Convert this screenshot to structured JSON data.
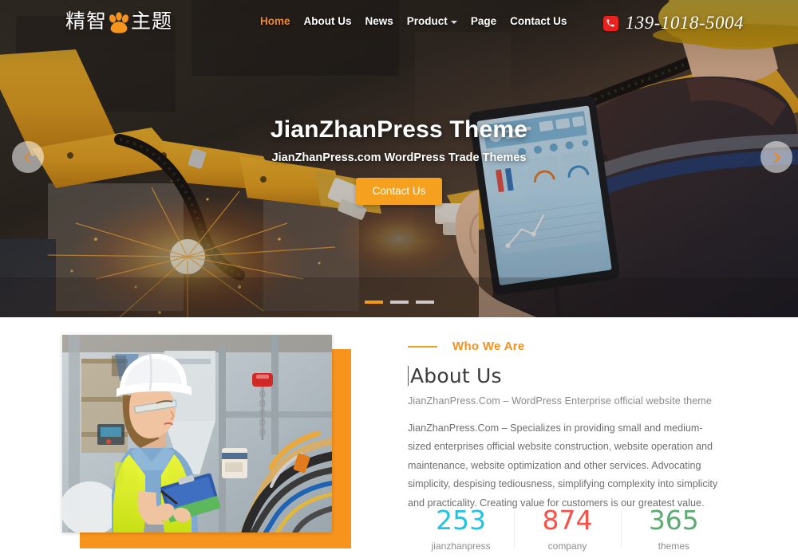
{
  "header": {
    "logo": {
      "text_left": "精智",
      "icon": "paw-icon",
      "text_right": "主题"
    },
    "nav": [
      {
        "label": "Home",
        "active": true,
        "has_dropdown": false
      },
      {
        "label": "About Us",
        "active": false,
        "has_dropdown": false
      },
      {
        "label": "News",
        "active": false,
        "has_dropdown": false
      },
      {
        "label": "Product",
        "active": false,
        "has_dropdown": true
      },
      {
        "label": "Page",
        "active": false,
        "has_dropdown": false
      },
      {
        "label": "Contact Us",
        "active": false,
        "has_dropdown": false
      }
    ],
    "phone": {
      "icon": "phone-icon",
      "number": "139-1018-5004",
      "icon_color": "#e8221f"
    }
  },
  "hero": {
    "title": "JianZhanPress Theme",
    "subtitle": "JianZhanPress.com WordPress Trade Themes",
    "button_label": "Contact Us",
    "button_color": "#f5a01e",
    "prev_label": "Previous slide",
    "next_label": "Next slide",
    "slides": [
      {
        "active": true
      },
      {
        "active": false
      },
      {
        "active": false
      }
    ]
  },
  "about": {
    "eyebrow": "Who We Are",
    "heading": "About Us",
    "lead": "JianZhanPress.Com – WordPress Enterprise official website theme",
    "body": "JianZhanPress.Com – Specializes in providing small and medium-sized enterprises official website construction, website operation and maintenance, website optimization and other services. Advocating simplicity, despising tediousness, simplifying complexity into simplicity and practicality. Creating value for customers is our greatest value.",
    "accent_color": "#f5a01e",
    "image_alt": "Female engineer with white hard hat and yellow safety vest holding clipboard in factory",
    "counters": [
      {
        "value": "253",
        "label": "jianzhanpress",
        "color": "#22c3e0"
      },
      {
        "value": "874",
        "label": "company",
        "color": "#f8514b"
      },
      {
        "value": "365",
        "label": "themes",
        "color": "#5cab72"
      }
    ]
  }
}
